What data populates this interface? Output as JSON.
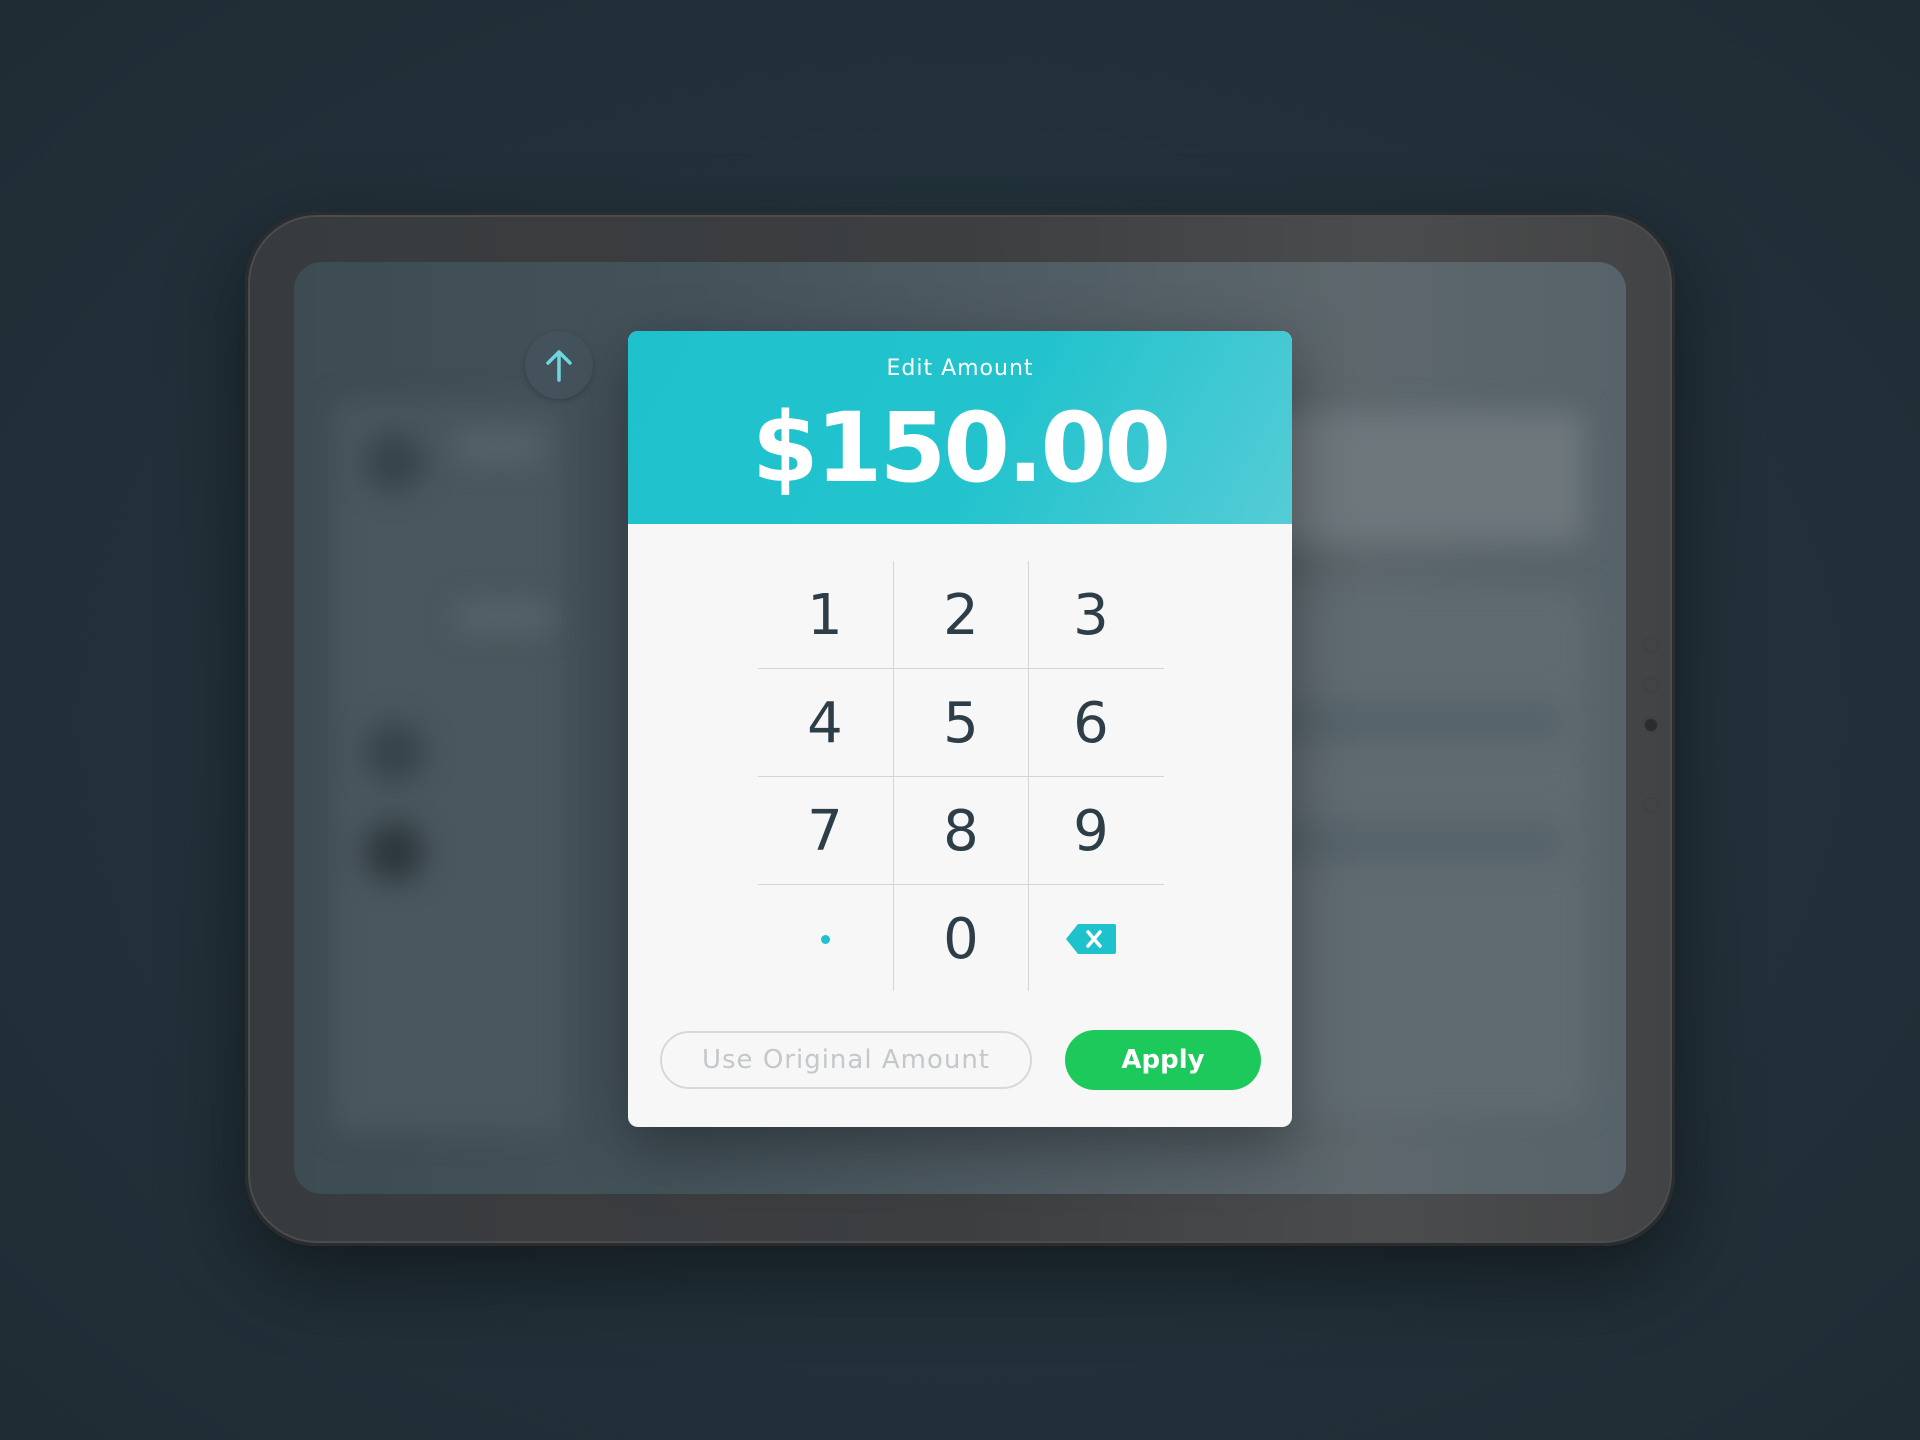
{
  "modal": {
    "title": "Edit Amount",
    "amount": "$150.00"
  },
  "keypad": {
    "keys": [
      "1",
      "2",
      "3",
      "4",
      "5",
      "6",
      "7",
      "8",
      "9",
      "0"
    ],
    "decimal_icon": "decimal-point-icon",
    "backspace_icon": "backspace-icon"
  },
  "actions": {
    "use_original_label": "Use Original Amount",
    "apply_label": "Apply"
  },
  "icons": {
    "up_button": "arrow-up-icon"
  },
  "colors": {
    "header_teal": "#1ec2cd",
    "apply_green": "#1ec95b",
    "key_text": "#2e3e48",
    "background": "#22303a"
  }
}
